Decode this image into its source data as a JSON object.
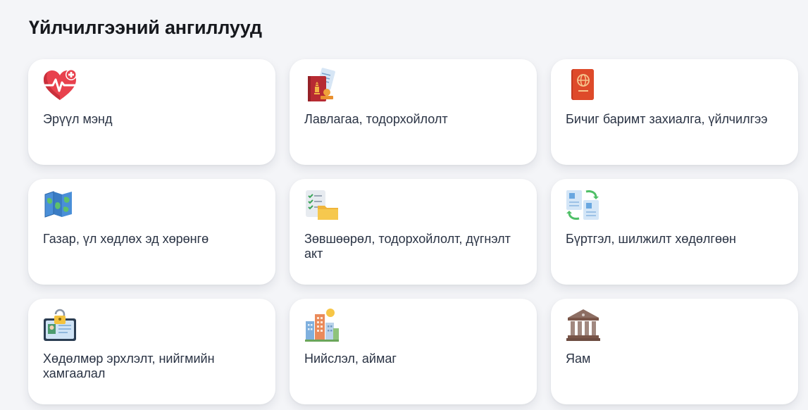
{
  "page": {
    "title": "Үйлчилгээний ангиллууд"
  },
  "categories": [
    {
      "label": "Эрүүл мэнд",
      "icon": "heart-health-icon"
    },
    {
      "label": "Лавлагаа, тодорхойлолт",
      "icon": "passport-document-icon"
    },
    {
      "label": "Бичиг баримт захиалга, үйлчилгээ",
      "icon": "passport-icon"
    },
    {
      "label": "Газар, үл хөдлөх эд хөрөнгө",
      "icon": "map-icon"
    },
    {
      "label": "Зөвшөөрөл, тодорхойлолт, дүгнэлт акт",
      "icon": "checklist-folder-icon"
    },
    {
      "label": "Бүртгэл, шилжилт хөдөлгөөн",
      "icon": "document-transfer-icon"
    },
    {
      "label": "Хөдөлмөр эрхлэлт, нийгмийн хамгаалал",
      "icon": "id-card-lock-icon"
    },
    {
      "label": "Нийслэл, аймаг",
      "icon": "city-buildings-icon"
    },
    {
      "label": "Яам",
      "icon": "government-building-icon"
    }
  ]
}
